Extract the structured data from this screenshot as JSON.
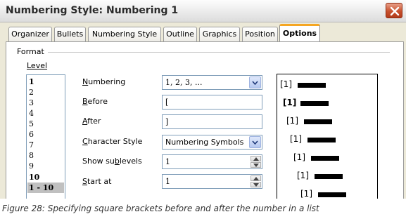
{
  "window": {
    "title": "Numbering Style: Numbering 1"
  },
  "tabs": [
    {
      "label": "Organizer"
    },
    {
      "label": "Bullets"
    },
    {
      "label": "Numbering Style"
    },
    {
      "label": "Outline"
    },
    {
      "label": "Graphics"
    },
    {
      "label": "Position"
    },
    {
      "label": "Options",
      "active": true
    }
  ],
  "format": {
    "group_label": "Format",
    "level_label": "Level",
    "levels": [
      "1",
      "2",
      "3",
      "4",
      "5",
      "6",
      "7",
      "8",
      "9",
      "10",
      "1 - 10"
    ],
    "selected_level": "1 - 10"
  },
  "fields": {
    "numbering": {
      "label": "Numbering",
      "value": "1, 2, 3, ..."
    },
    "before": {
      "label": "Before",
      "value": "["
    },
    "after": {
      "label": "After",
      "value": "]"
    },
    "character_style": {
      "label": "Character Style",
      "value": "Numbering Symbols"
    },
    "show_sublevels": {
      "label": "Show sublevels",
      "value": "1"
    },
    "start_at": {
      "label": "Start at",
      "value": "1"
    }
  },
  "preview": {
    "item_label": "[1]"
  },
  "caption": "Figure 28: Specifying square brackets before and after the number in a list",
  "colors": {
    "active_tab_accent": "#f5a623",
    "close_button": "#c8502d",
    "selected_level": "#c0c0c0"
  }
}
